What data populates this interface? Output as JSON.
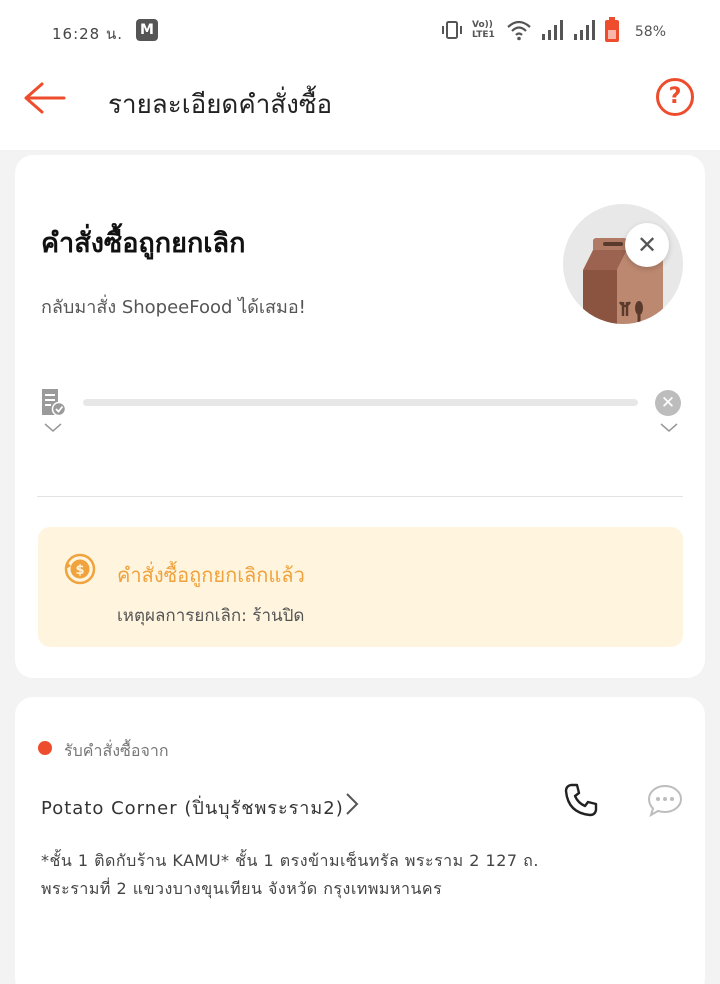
{
  "status_bar": {
    "time": "16:28",
    "time_suffix": "น.",
    "notif_letter": "M",
    "volte": "Vo)) LTE1",
    "battery": "58%"
  },
  "header": {
    "title": "รายละเอียดคำสั่งซื้อ",
    "help_label": "?"
  },
  "status": {
    "title": "คำสั่งซื้อถูกยกเลิก",
    "subtitle": "กลับมาสั่ง ShopeeFood ได้เสมอ!"
  },
  "cancel_notice": {
    "title": "คำสั่งซื้อถูกยกเลิกแล้ว",
    "reason": "เหตุผลการยกเลิก: ร้านปิด"
  },
  "pickup": {
    "label": "รับคำสั่งซื้อจาก",
    "restaurant": "Potato Corner (ปิ่นบุรัชพระราม2)",
    "address": "*ชั้น 1 ติดกับร้าน KAMU* ชั้น 1 ตรงข้ามเซ็นทรัล พระราม 2 127 ถ. พระรามที่ 2 แขวงบางขุนเทียน จังหวัด กรุงเทพมหานคร"
  },
  "colors": {
    "accent": "#ee4d2d",
    "warning": "#f0a23c",
    "warning_bg": "#fff5df"
  }
}
